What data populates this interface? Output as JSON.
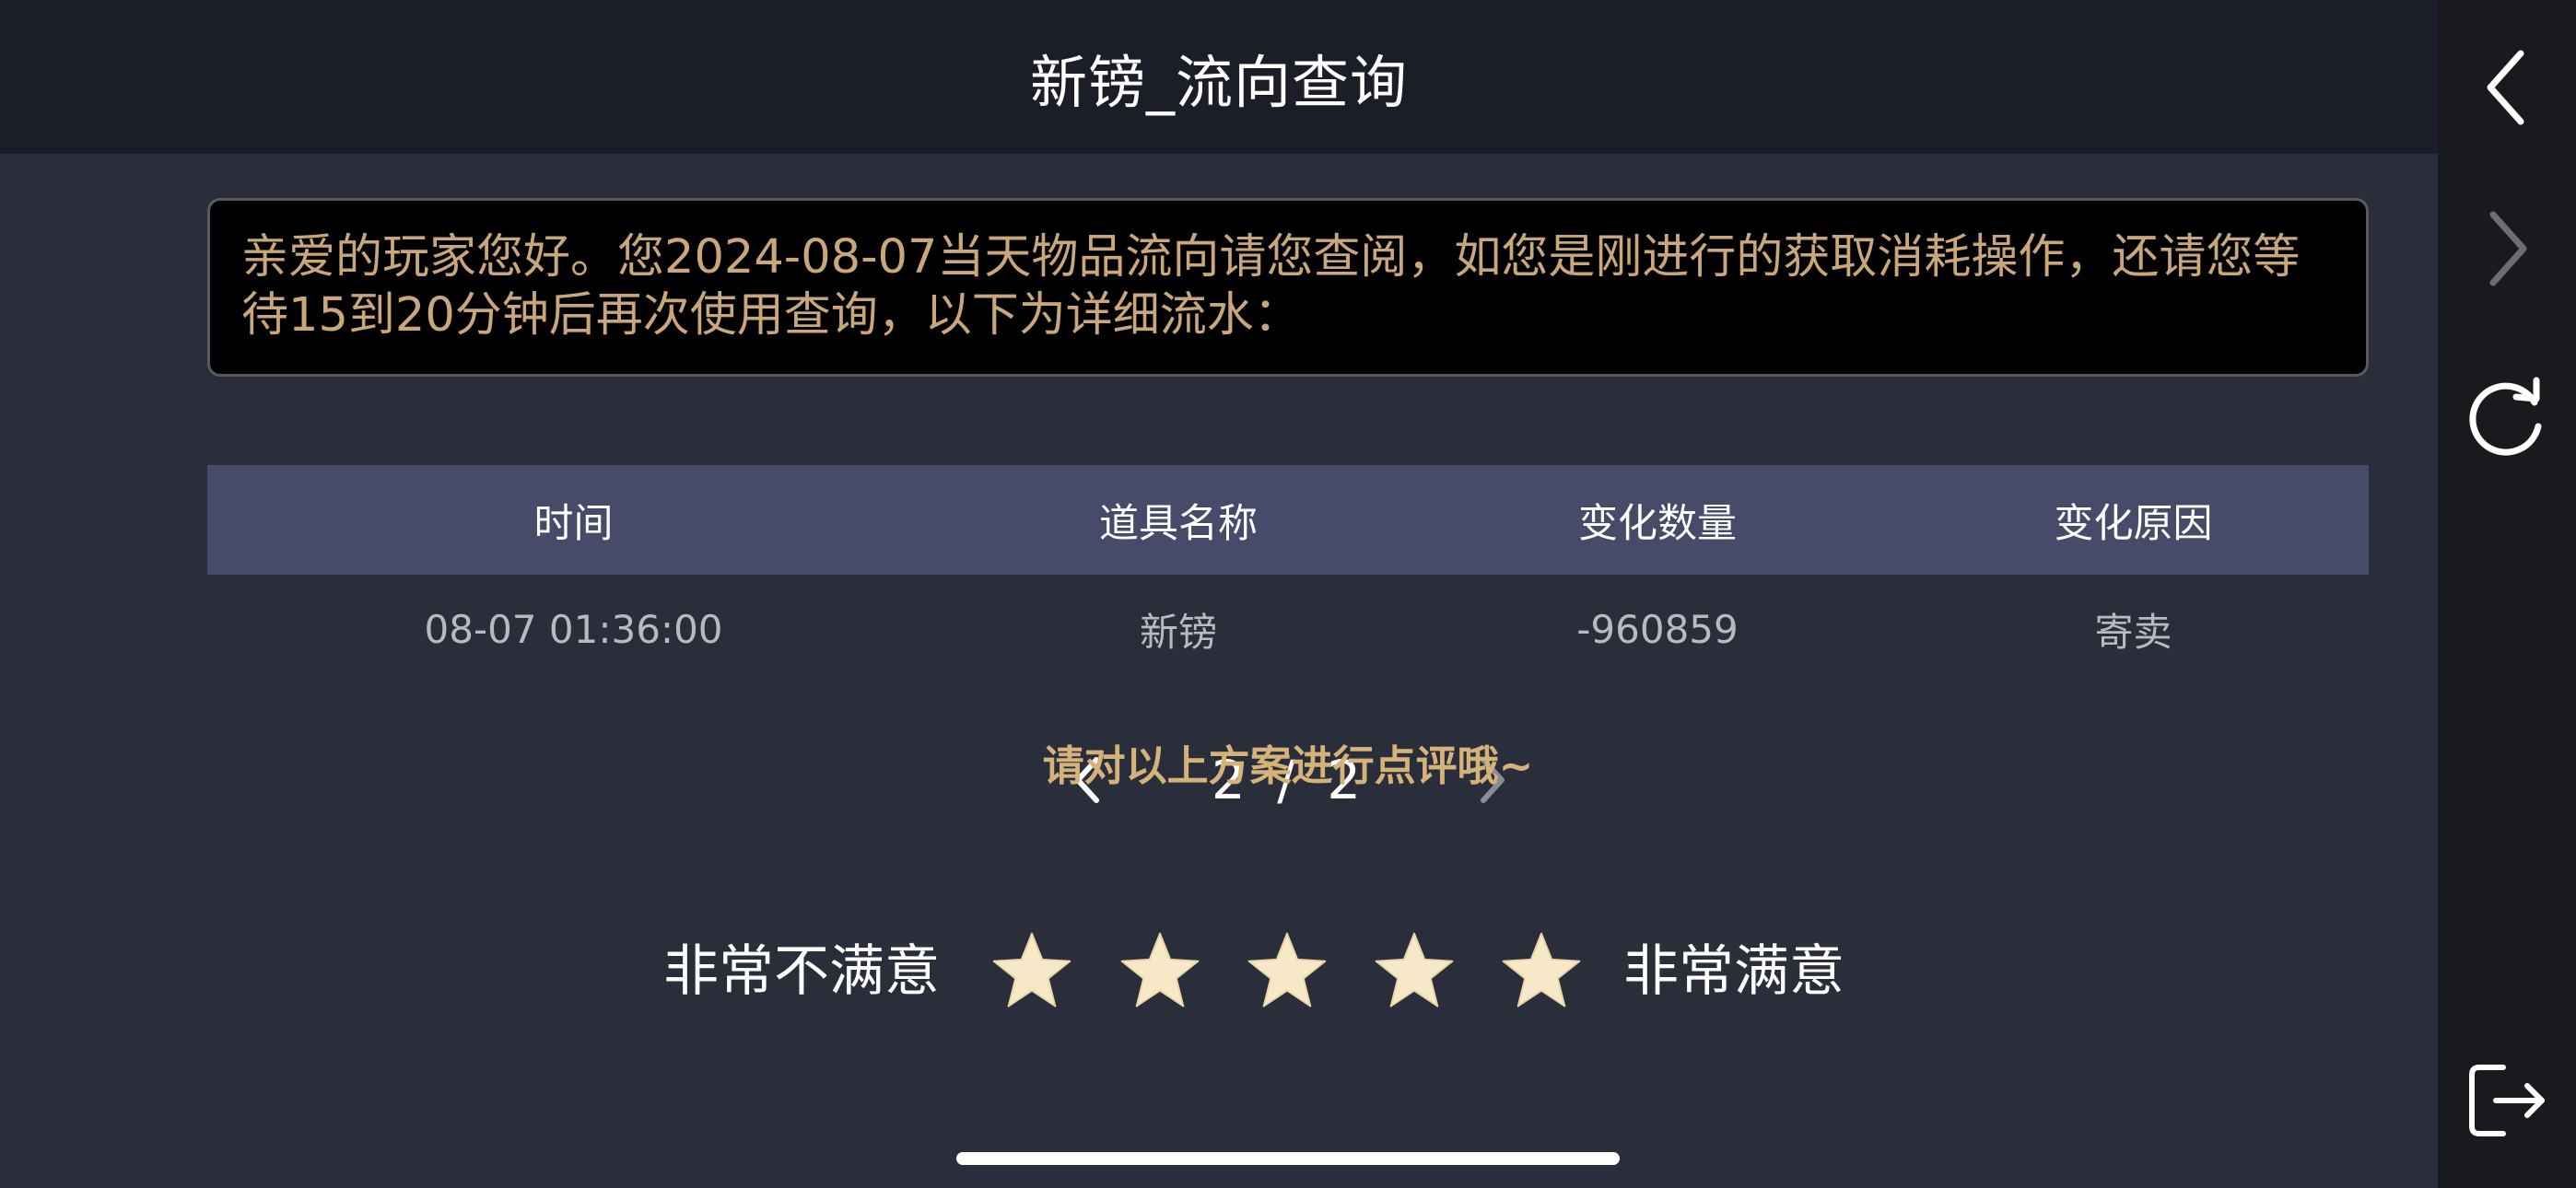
{
  "header": {
    "title": "新镑_流向查询"
  },
  "notice": {
    "text": "亲爱的玩家您好。您2024-08-07当天物品流向请您查阅，如您是刚进行的获取消耗操作，还请您等待15到20分钟后再次使用查询，以下为详细流水："
  },
  "table": {
    "columns": [
      "时间",
      "道具名称",
      "变化数量",
      "变化原因"
    ],
    "rows": [
      [
        "08-07 01:36:00",
        "新镑",
        "-960859",
        "寄卖"
      ]
    ]
  },
  "pager": {
    "text": "2 / 2",
    "current": 2,
    "total": 2
  },
  "rating": {
    "prompt": "请对以上方案进行点评哦~",
    "low_label": "非常不满意",
    "high_label": "非常满意",
    "star_count": 5,
    "star_color": "#f7e8c8"
  },
  "rail": {
    "icons": [
      "back-icon",
      "forward-icon",
      "refresh-icon",
      "exit-icon"
    ]
  },
  "colors": {
    "header_bg": "#1b1d28",
    "main_bg": "#2a2d3a",
    "notice_text": "#c9a77a",
    "table_header_bg": "#474a68",
    "accent_gold": "#d4b27a"
  }
}
